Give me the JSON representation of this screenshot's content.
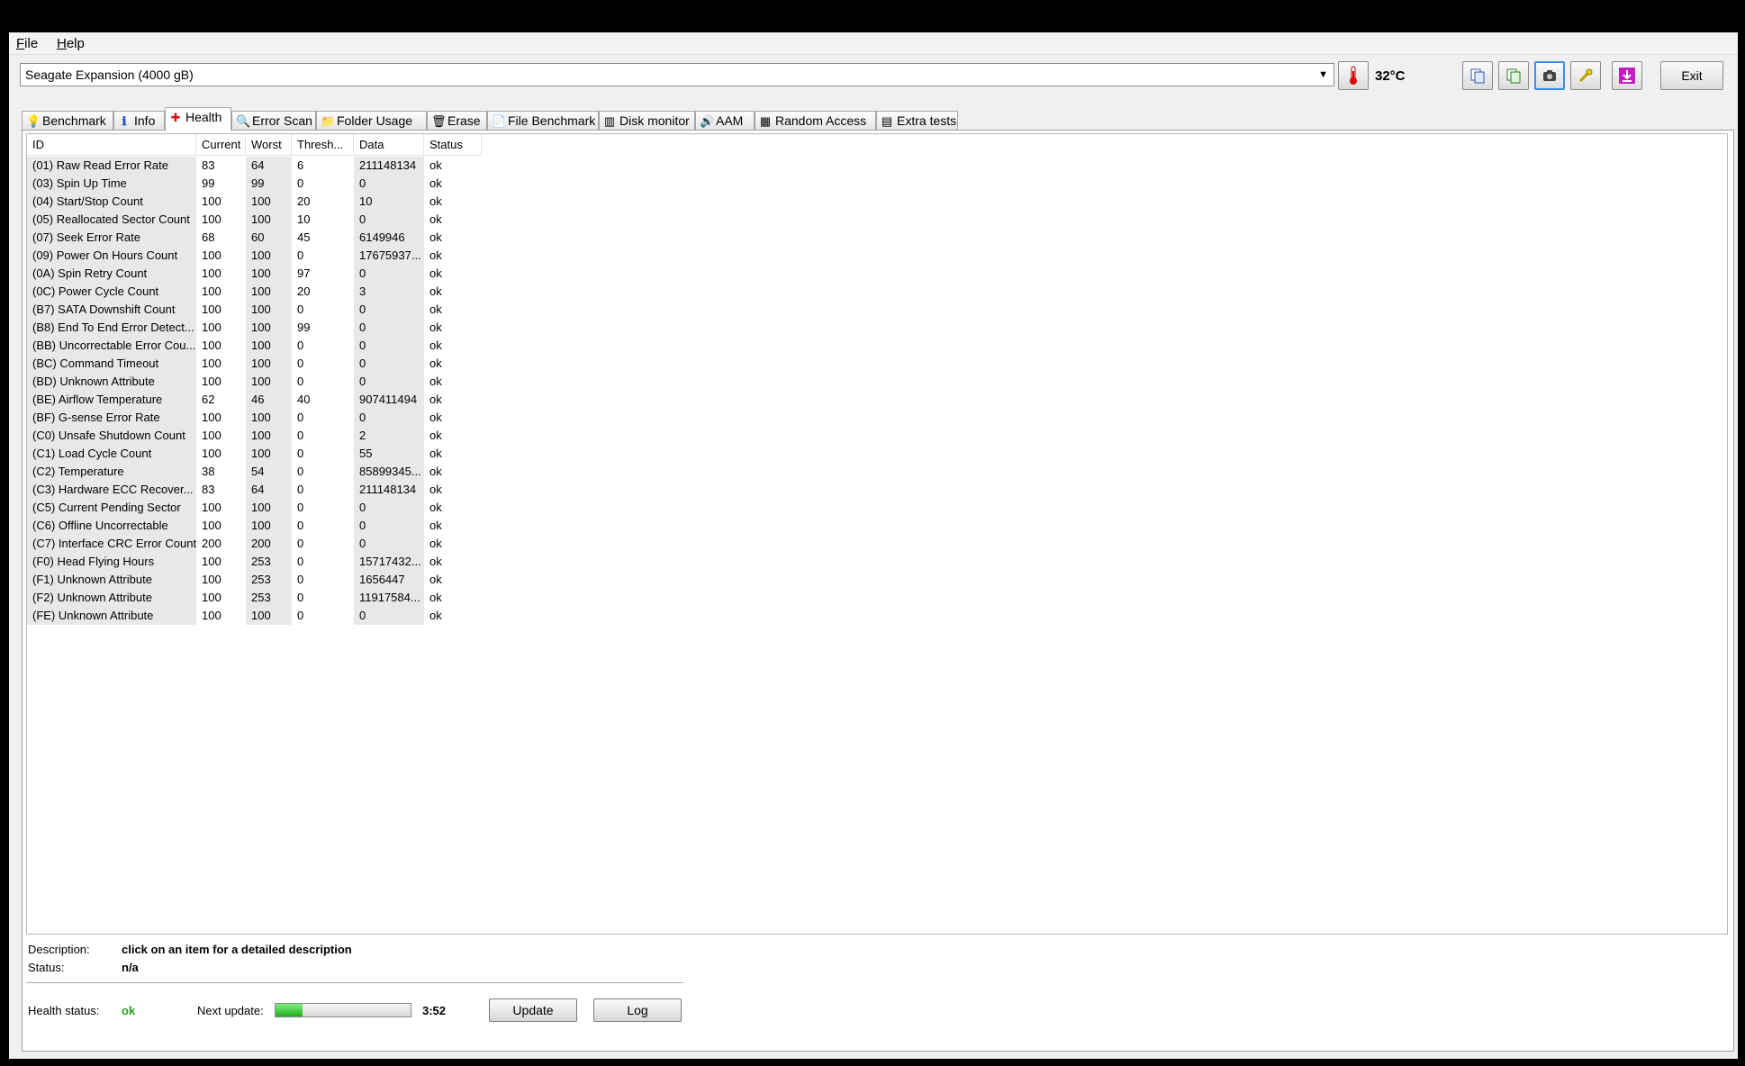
{
  "menu": [
    {
      "label": "File"
    },
    {
      "label": "Help"
    }
  ],
  "drive": {
    "selected": "Seagate Expansion (4000 gB)"
  },
  "temperature": {
    "value": "32°C"
  },
  "toolbar": {
    "exit_label": "Exit"
  },
  "tabs": [
    {
      "label": "Benchmark",
      "icon": "lightbulb-icon",
      "glyph": "💡"
    },
    {
      "label": "Info",
      "icon": "info-icon",
      "glyph": "ℹ"
    },
    {
      "label": "Health",
      "icon": "red-cross-icon",
      "glyph": "✚",
      "active": true
    },
    {
      "label": "Error Scan",
      "icon": "magnifier-icon",
      "glyph": "🔍"
    },
    {
      "label": "Folder Usage",
      "icon": "folder-icon",
      "glyph": "📁"
    },
    {
      "label": "Erase",
      "icon": "trash-icon",
      "glyph": "🗑"
    },
    {
      "label": "File Benchmark",
      "icon": "file-icon",
      "glyph": "📄"
    },
    {
      "label": "Disk monitor",
      "icon": "chart-icon",
      "glyph": "▥"
    },
    {
      "label": "AAM",
      "icon": "speaker-icon",
      "glyph": "🔊"
    },
    {
      "label": "Random Access",
      "icon": "scatter-icon",
      "glyph": "▦"
    },
    {
      "label": "Extra tests",
      "icon": "grid-icon",
      "glyph": "▤"
    }
  ],
  "table": {
    "columns": [
      "ID",
      "Current",
      "Worst",
      "Thresh...",
      "Data",
      "Status"
    ],
    "rows": [
      [
        "(01) Raw Read Error Rate",
        "83",
        "64",
        "6",
        "211148134",
        "ok"
      ],
      [
        "(03) Spin Up Time",
        "99",
        "99",
        "0",
        "0",
        "ok"
      ],
      [
        "(04) Start/Stop Count",
        "100",
        "100",
        "20",
        "10",
        "ok"
      ],
      [
        "(05) Reallocated Sector Count",
        "100",
        "100",
        "10",
        "0",
        "ok"
      ],
      [
        "(07) Seek Error Rate",
        "68",
        "60",
        "45",
        "6149946",
        "ok"
      ],
      [
        "(09) Power On Hours Count",
        "100",
        "100",
        "0",
        "17675937...",
        "ok"
      ],
      [
        "(0A) Spin Retry Count",
        "100",
        "100",
        "97",
        "0",
        "ok"
      ],
      [
        "(0C) Power Cycle Count",
        "100",
        "100",
        "20",
        "3",
        "ok"
      ],
      [
        "(B7) SATA Downshift Count",
        "100",
        "100",
        "0",
        "0",
        "ok"
      ],
      [
        "(B8) End To End Error Detect...",
        "100",
        "100",
        "99",
        "0",
        "ok"
      ],
      [
        "(BB) Uncorrectable Error Cou...",
        "100",
        "100",
        "0",
        "0",
        "ok"
      ],
      [
        "(BC) Command Timeout",
        "100",
        "100",
        "0",
        "0",
        "ok"
      ],
      [
        "(BD) Unknown Attribute",
        "100",
        "100",
        "0",
        "0",
        "ok"
      ],
      [
        "(BE) Airflow Temperature",
        "62",
        "46",
        "40",
        "907411494",
        "ok"
      ],
      [
        "(BF) G-sense Error Rate",
        "100",
        "100",
        "0",
        "0",
        "ok"
      ],
      [
        "(C0) Unsafe Shutdown Count",
        "100",
        "100",
        "0",
        "2",
        "ok"
      ],
      [
        "(C1) Load Cycle Count",
        "100",
        "100",
        "0",
        "55",
        "ok"
      ],
      [
        "(C2) Temperature",
        "38",
        "54",
        "0",
        "85899345...",
        "ok"
      ],
      [
        "(C3) Hardware ECC Recover...",
        "83",
        "64",
        "0",
        "211148134",
        "ok"
      ],
      [
        "(C5) Current Pending Sector",
        "100",
        "100",
        "0",
        "0",
        "ok"
      ],
      [
        "(C6) Offline Uncorrectable",
        "100",
        "100",
        "0",
        "0",
        "ok"
      ],
      [
        "(C7) Interface CRC Error Count",
        "200",
        "200",
        "0",
        "0",
        "ok"
      ],
      [
        "(F0) Head Flying Hours",
        "100",
        "253",
        "0",
        "15717432...",
        "ok"
      ],
      [
        "(F1) Unknown Attribute",
        "100",
        "253",
        "0",
        "1656447",
        "ok"
      ],
      [
        "(F2) Unknown Attribute",
        "100",
        "253",
        "0",
        "11917584...",
        "ok"
      ],
      [
        "(FE) Unknown Attribute",
        "100",
        "100",
        "0",
        "0",
        "ok"
      ]
    ]
  },
  "details": {
    "description_label": "Description:",
    "description_value": "click on an item for a detailed description",
    "status_label": "Status:",
    "status_value": "n/a"
  },
  "footer": {
    "health_label": "Health status:",
    "health_value": "ok",
    "health_color": "#1aa31a",
    "next_update_label": "Next update:",
    "progress_fraction": 0.2,
    "countdown": "3:52",
    "update_label": "Update",
    "log_label": "Log"
  }
}
